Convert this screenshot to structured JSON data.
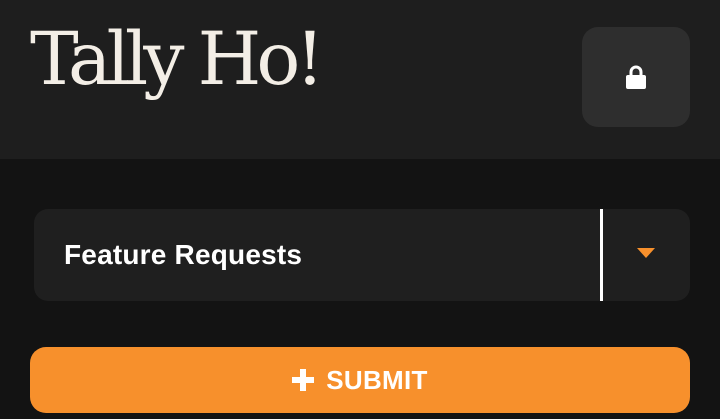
{
  "header": {
    "logo_text": "Tally Ho!",
    "lock_icon": "lock-icon"
  },
  "category_select": {
    "selected_value": "Feature Requests",
    "arrow_icon": "caret-down-icon"
  },
  "submit": {
    "icon": "plus-icon",
    "label": "SUBMIT"
  },
  "colors": {
    "background": "#131313",
    "header_background": "#1e1e1e",
    "accent": "#f7902c",
    "logo_text": "#f3eee6"
  }
}
